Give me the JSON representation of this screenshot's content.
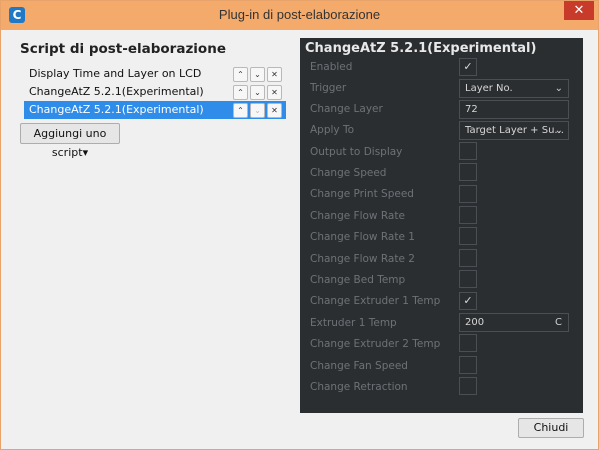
{
  "window": {
    "title": "Plug-in di post-elaborazione",
    "app_icon": "C",
    "close_glyph": "✕"
  },
  "left": {
    "title": "Script di post-elaborazione",
    "scripts": [
      {
        "label": "Display Time and Layer on LCD",
        "selected": false
      },
      {
        "label": "ChangeAtZ 5.2.1(Experimental)",
        "selected": false
      },
      {
        "label": "ChangeAtZ 5.2.1(Experimental)",
        "selected": true
      }
    ],
    "up_glyph": "⌃",
    "down_glyph": "⌄",
    "remove_glyph": "✕",
    "add_script_label": "Aggiungi uno script",
    "add_script_arrow": "▾"
  },
  "panel": {
    "title": "ChangeAtZ 5.2.1(Experimental)",
    "check_glyph": "✓",
    "chevron_glyph": "⌄",
    "settings": [
      {
        "label": "Enabled",
        "type": "checkbox",
        "checked": true
      },
      {
        "label": "Trigger",
        "type": "select",
        "value": "Layer No."
      },
      {
        "label": "Change Layer",
        "type": "text",
        "value": "72"
      },
      {
        "label": "Apply To",
        "type": "select",
        "value": "Target Layer + Su..."
      },
      {
        "label": "Output to Display",
        "type": "checkbox",
        "checked": false
      },
      {
        "label": "Change Speed",
        "type": "checkbox",
        "checked": false
      },
      {
        "label": "Change Print Speed",
        "type": "checkbox",
        "checked": false
      },
      {
        "label": "Change Flow Rate",
        "type": "checkbox",
        "checked": false
      },
      {
        "label": "Change Flow Rate 1",
        "type": "checkbox",
        "checked": false
      },
      {
        "label": "Change Flow Rate 2",
        "type": "checkbox",
        "checked": false
      },
      {
        "label": "Change Bed Temp",
        "type": "checkbox",
        "checked": false
      },
      {
        "label": "Change Extruder 1 Temp",
        "type": "checkbox",
        "checked": true
      },
      {
        "label": "Extruder 1 Temp",
        "type": "text",
        "value": "200",
        "unit": "C"
      },
      {
        "label": "Change Extruder 2 Temp",
        "type": "checkbox",
        "checked": false
      },
      {
        "label": "Change Fan Speed",
        "type": "checkbox",
        "checked": false
      },
      {
        "label": "Change Retraction",
        "type": "checkbox",
        "checked": false
      }
    ]
  },
  "footer": {
    "close_label": "Chiudi"
  },
  "colors": {
    "titlebar": "#f4aa6b",
    "selection": "#2f8ce9",
    "panel_bg": "#2b2e31",
    "close_red": "#c83a2a"
  }
}
